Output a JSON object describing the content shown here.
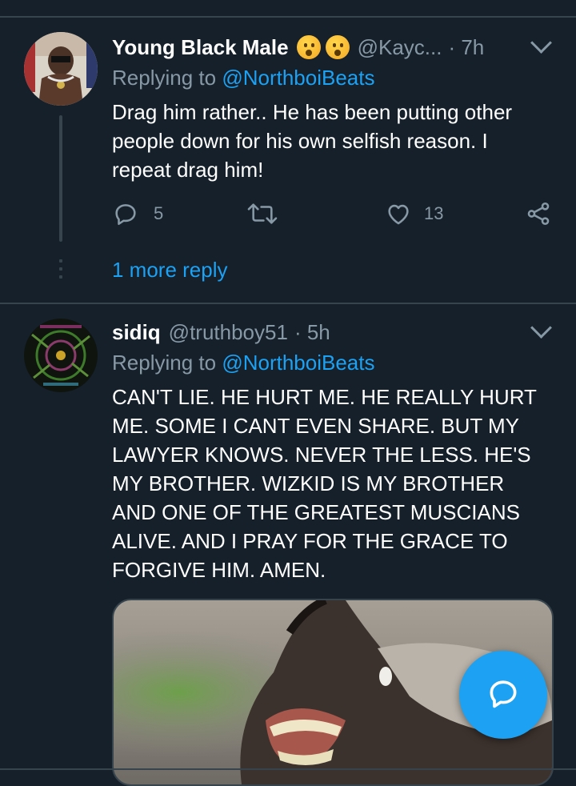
{
  "tweets": [
    {
      "name": "Young Black Male",
      "handle": "@Kayc...",
      "time": "· 7h",
      "replying_prefix": "Replying to ",
      "replying_to": "@NorthboiBeats",
      "body": "Drag him rather.. He has been putting other people down for his own selfish reason. I repeat drag him!",
      "reply_count": "5",
      "like_count": "13"
    },
    {
      "name": "sidiq",
      "handle": "@truthboy51",
      "time": "· 5h",
      "replying_prefix": "Replying to ",
      "replying_to": "@NorthboiBeats",
      "body": "CAN'T LIE. HE HURT ME. HE REALLY HURT ME. SOME I CANT EVEN SHARE. BUT MY LAWYER KNOWS. NEVER THE LESS. HE'S MY BROTHER. WIZKID IS MY BROTHER AND ONE OF THE GREATEST MUSCIANS ALIVE. AND I PRAY FOR THE GRACE TO FORGIVE HIM. AMEN."
    }
  ],
  "more_replies": "1 more reply",
  "colors": {
    "background": "#15202b",
    "divider": "#38444d",
    "secondary_text": "#8899a6",
    "accent": "#1da1f2"
  },
  "icons": [
    "reply-icon",
    "retweet-icon",
    "like-icon",
    "share-icon",
    "chevron-down-icon",
    "compose-icon"
  ]
}
